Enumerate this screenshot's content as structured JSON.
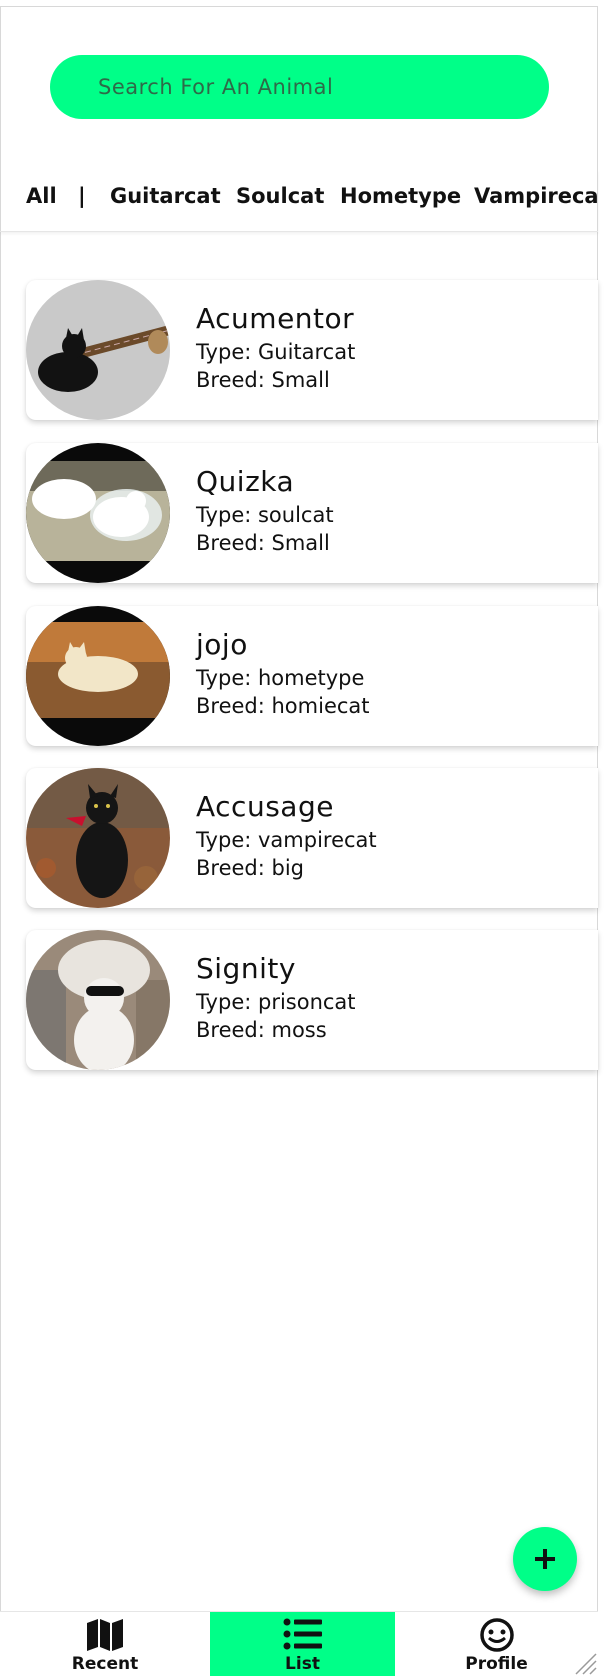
{
  "search": {
    "placeholder": "Search For An Animal"
  },
  "filters": [
    {
      "label": "All"
    },
    {
      "label": "|"
    },
    {
      "label": "Guitarcat"
    },
    {
      "label": "Soulcat"
    },
    {
      "label": "Hometype"
    },
    {
      "label": "Vampirecat"
    }
  ],
  "pets": [
    {
      "name": "Acumentor",
      "type": "Type: Guitarcat",
      "breed": "Breed: Small"
    },
    {
      "name": "Quizka",
      "type": "Type: soulcat",
      "breed": "Breed: Small"
    },
    {
      "name": "jojo",
      "type": "Type: hometype",
      "breed": "Breed: homiecat"
    },
    {
      "name": "Accusage",
      "type": "Type: vampirecat",
      "breed": "Breed: big"
    },
    {
      "name": "Signity",
      "type": "Type: prisoncat",
      "breed": "Breed: moss"
    }
  ],
  "fab": {
    "icon": "plus-icon"
  },
  "nav": [
    {
      "label": "Recent",
      "icon": "map-icon"
    },
    {
      "label": "List",
      "icon": "list-icon",
      "active": true
    },
    {
      "label": "Profile",
      "icon": "face-icon"
    }
  ],
  "colors": {
    "accent": "#00ff88",
    "text": "#111111",
    "background": "#ffffff"
  }
}
